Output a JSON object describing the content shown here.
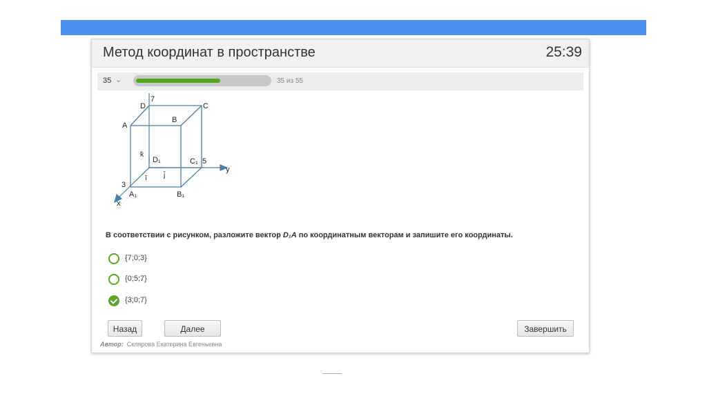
{
  "header": {
    "title": "Метод координат в пространстве",
    "timer": "25:39"
  },
  "progress": {
    "question_number": "35",
    "current": 35,
    "total": 55,
    "text": "35 из 55",
    "accent_color": "#52a71d"
  },
  "figure": {
    "axis_z": "z",
    "axis_y": "y",
    "axis_x": "x",
    "num_7": "7",
    "num_5": "5",
    "num_3": "3",
    "vertex_D": "D",
    "vertex_C": "C",
    "vertex_A": "A",
    "vertex_B": "B",
    "vertex_D1": "D₁",
    "vertex_C1": "C₁",
    "vertex_A1": "A₁",
    "vertex_B1": "B₁",
    "vec_k": "k̄",
    "vec_i": "ī",
    "vec_j": "j̄"
  },
  "question": {
    "text_before": "В соответствии с рисунком, разложите вектор ",
    "vector": "D₁A",
    "text_after": " по координатным векторам и запишите его координаты."
  },
  "options": [
    {
      "label": "{7;0;3}",
      "selected": false
    },
    {
      "label": "{0;5;7}",
      "selected": false
    },
    {
      "label": "{3;0;7}",
      "selected": true
    }
  ],
  "buttons": {
    "back": "Назад",
    "next": "Далее",
    "finish": "Завершить"
  },
  "author": {
    "label": "Автор:",
    "name": "Склярова Екатерина Евгеньевна"
  }
}
